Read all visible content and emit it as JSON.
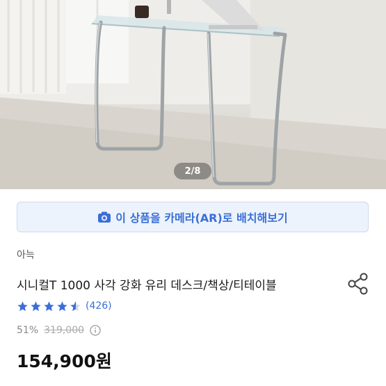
{
  "gallery": {
    "counter": "2/8"
  },
  "ar_button": {
    "label": "이 상품을 카메라(AR)로 배치해보기",
    "icon": "camera-icon",
    "color": "#3a6fd8"
  },
  "product": {
    "brand": "아늑",
    "title": "시니컬T 1000 사각 강화 유리 데스크/책상/티테이블",
    "rating": 4.5,
    "rating_max": 5,
    "review_count": "(426)",
    "discount": "51%",
    "original_price": "319,000",
    "price": "154,900원"
  },
  "icons": {
    "share": "share-icon",
    "info": "info-icon",
    "star": "star-icon"
  },
  "colors": {
    "accent": "#3a6fd8",
    "star": "#3a6fd8",
    "ar_background": "#edf3fc"
  }
}
